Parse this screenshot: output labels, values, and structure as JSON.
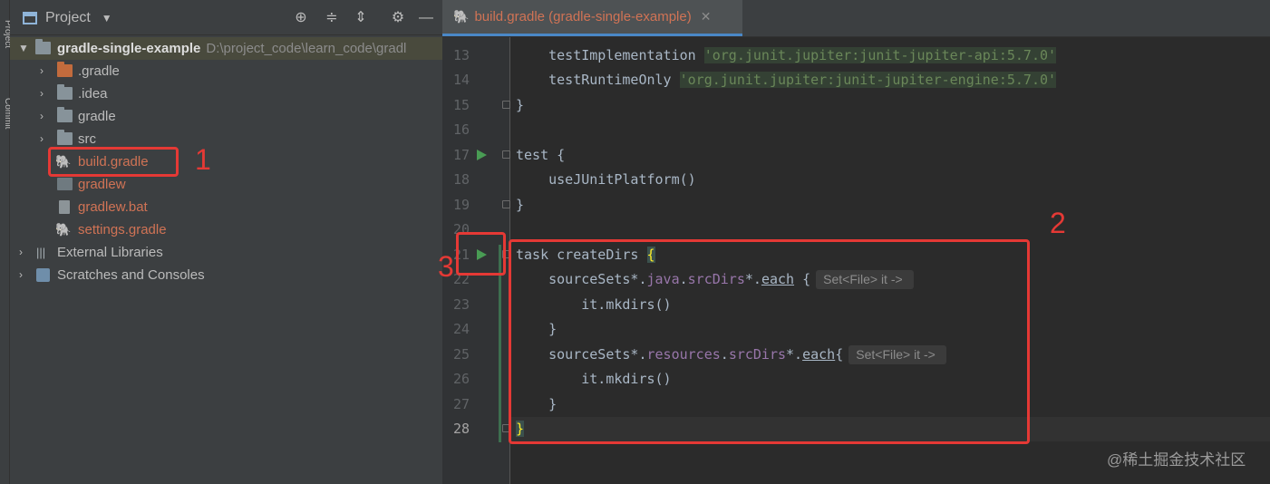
{
  "sidebar_strip": {
    "label_top": "Project",
    "label_bottom": "Commit"
  },
  "project_pane": {
    "title": "Project",
    "tree": [
      {
        "label": "gradle-single-example",
        "path": "D:\\project_code\\learn_code\\gradl",
        "type": "root"
      },
      {
        "label": ".gradle",
        "type": "folder"
      },
      {
        "label": ".idea",
        "type": "folder"
      },
      {
        "label": "gradle",
        "type": "folder"
      },
      {
        "label": "src",
        "type": "folder"
      },
      {
        "label": "build.gradle",
        "type": "file"
      },
      {
        "label": "gradlew",
        "type": "file"
      },
      {
        "label": "gradlew.bat",
        "type": "file"
      },
      {
        "label": "settings.gradle",
        "type": "file"
      },
      {
        "label": "External Libraries",
        "type": "library"
      },
      {
        "label": "Scratches and Consoles",
        "type": "scratch"
      }
    ]
  },
  "editor": {
    "tab_label": "build.gradle (gradle-single-example)",
    "lines": [
      {
        "n": "13"
      },
      {
        "n": "14"
      },
      {
        "n": "15"
      },
      {
        "n": "16"
      },
      {
        "n": "17"
      },
      {
        "n": "18"
      },
      {
        "n": "19"
      },
      {
        "n": "20"
      },
      {
        "n": "21"
      },
      {
        "n": "22"
      },
      {
        "n": "23"
      },
      {
        "n": "24"
      },
      {
        "n": "25"
      },
      {
        "n": "26"
      },
      {
        "n": "27"
      },
      {
        "n": "28"
      }
    ],
    "code": {
      "l13_method": "testImplementation",
      "l13_string": "'org.junit.jupiter:junit-jupiter-api:5.7.0'",
      "l14_method": "testRuntimeOnly",
      "l14_string": "'org.junit.jupiter:junit-jupiter-engine:5.7.0'",
      "l15": "}",
      "l17": "test {",
      "l18": "useJUnitPlatform()",
      "l19": "}",
      "l21_task": "task createDirs ",
      "l21_brace": "{",
      "l22_a": "sourceSets*.",
      "l22_java": "java",
      "l22_dot": ".",
      "l22_src": "srcDirs",
      "l22_star": "*.",
      "l22_each": "each",
      "l22_brace": " {",
      "l22_hint": "Set<File> it ->",
      "l23": "it.mkdirs()",
      "l24": "}",
      "l25_a": "sourceSets*.",
      "l25_res": "resources",
      "l25_dot": ".",
      "l25_src": "srcDirs",
      "l25_star": "*.",
      "l25_each": "each",
      "l25_brace": "{",
      "l25_hint": "Set<File> it ->",
      "l26": "it.mkdirs()",
      "l27": "}",
      "l28": "}"
    }
  },
  "annotations": {
    "one": "1",
    "two": "2",
    "three": "3"
  },
  "watermark": "@稀土掘金技术社区",
  "colors": {
    "annotation_red": "#e53935",
    "accent_blue": "#4a88c7",
    "run_green": "#499c54"
  }
}
